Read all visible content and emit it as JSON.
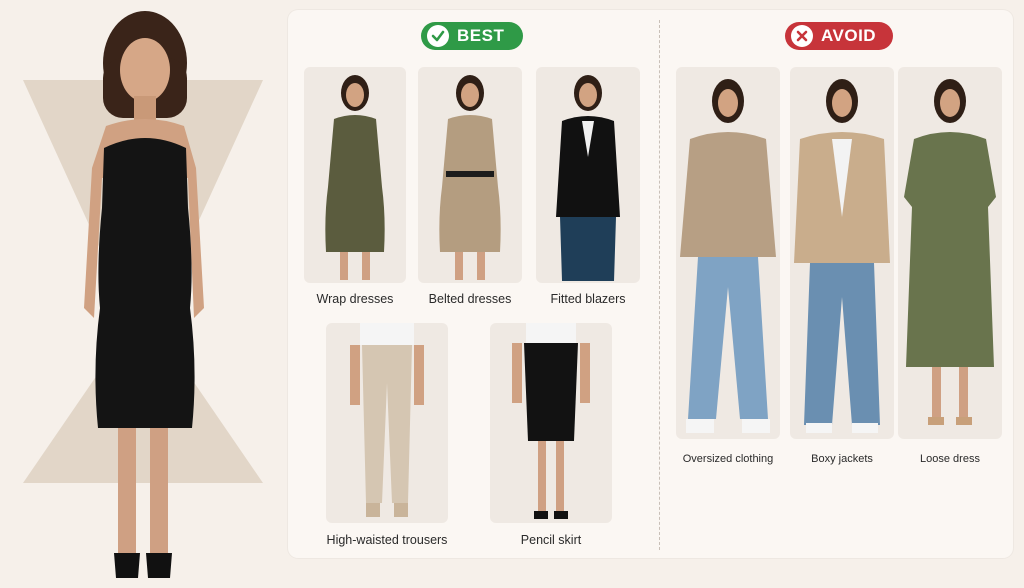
{
  "best": {
    "badge": "BEST",
    "items": [
      {
        "label": "Wrap dresses"
      },
      {
        "label": "Belted dresses"
      },
      {
        "label": "Fitted blazers"
      },
      {
        "label": "High-waisted trousers"
      },
      {
        "label": "Pencil skirt"
      }
    ]
  },
  "avoid": {
    "badge": "AVOID",
    "items": [
      {
        "label": "Oversized clothing"
      },
      {
        "label": "Boxy jackets"
      },
      {
        "label": "Loose dress"
      }
    ]
  },
  "colors": {
    "best": "#2f9a47",
    "avoid": "#c7343a",
    "background": "#f6f0ea",
    "card": "#fbf7f3"
  },
  "icons": {
    "best": "check-icon",
    "avoid": "x-icon"
  }
}
